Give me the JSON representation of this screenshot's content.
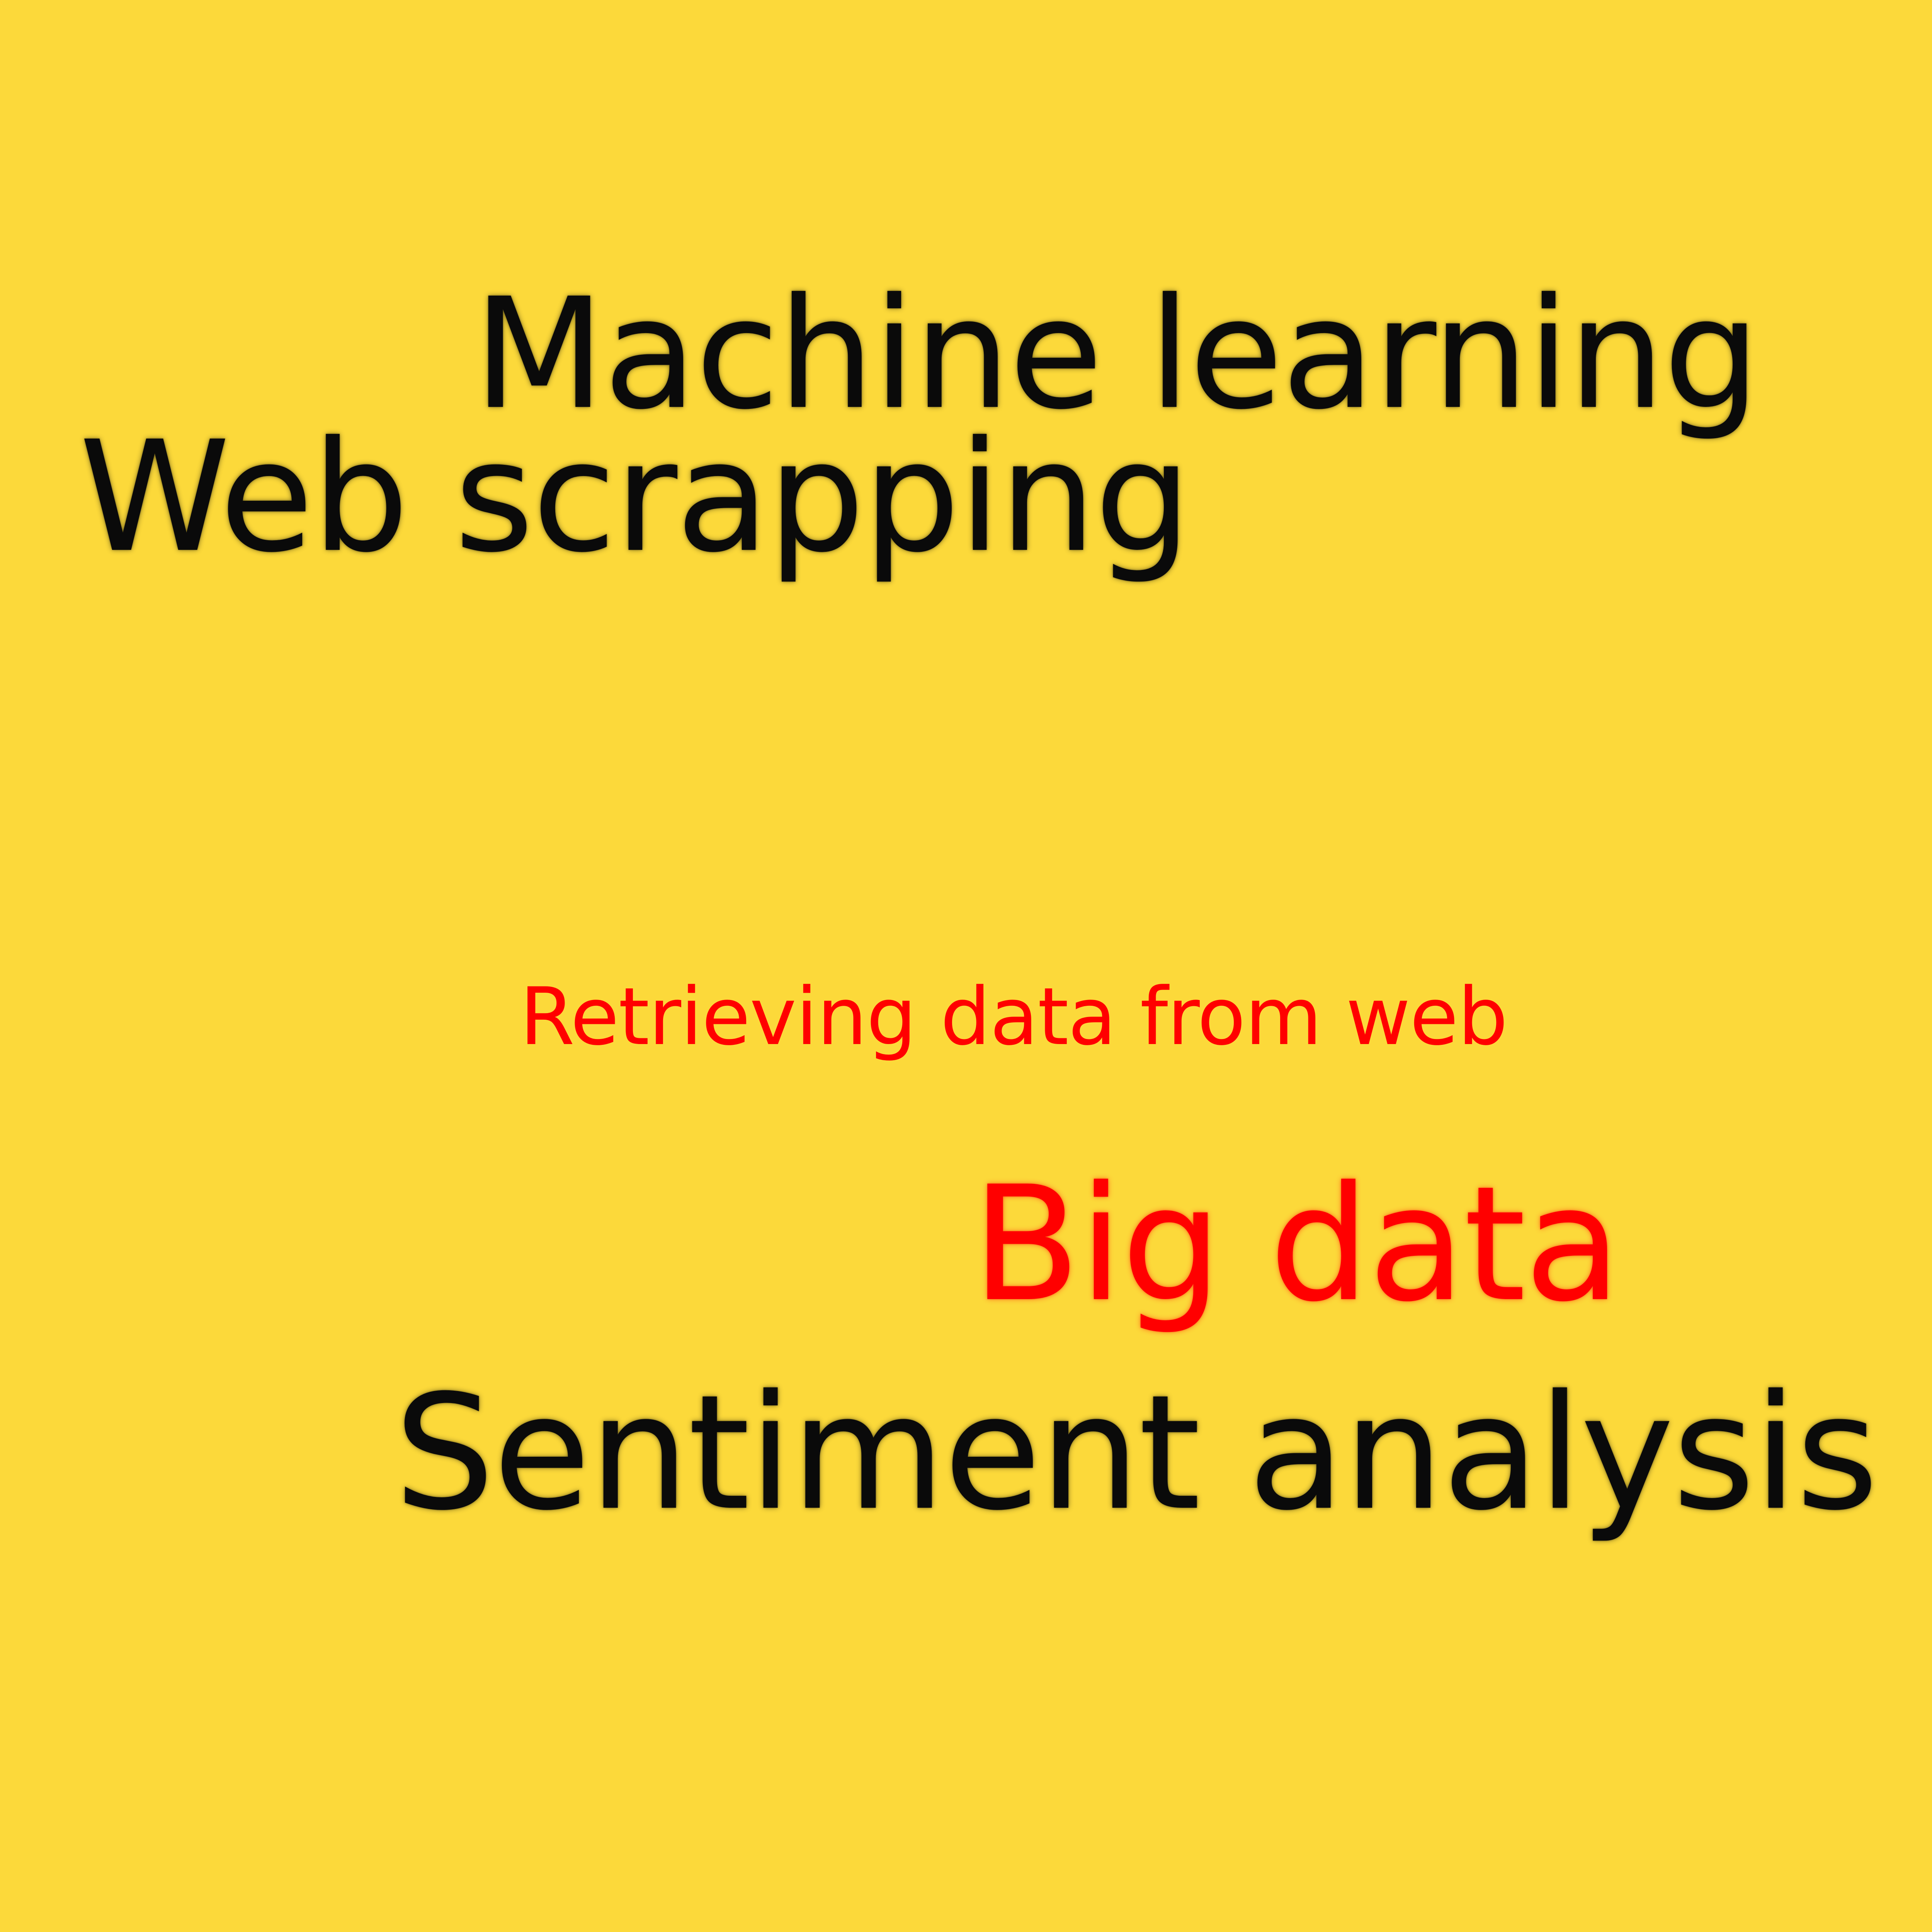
{
  "colors": {
    "background": "#FCD93A",
    "dark_text": "#0a0a0a",
    "accent_text": "#FF0000"
  },
  "words": {
    "machine_learning": "Machine learning",
    "web_scrapping": "Web scrapping",
    "retrieving_data": "Retrieving data from web",
    "big_data": "Big data",
    "sentiment_analysis": "Sentiment analysis"
  }
}
